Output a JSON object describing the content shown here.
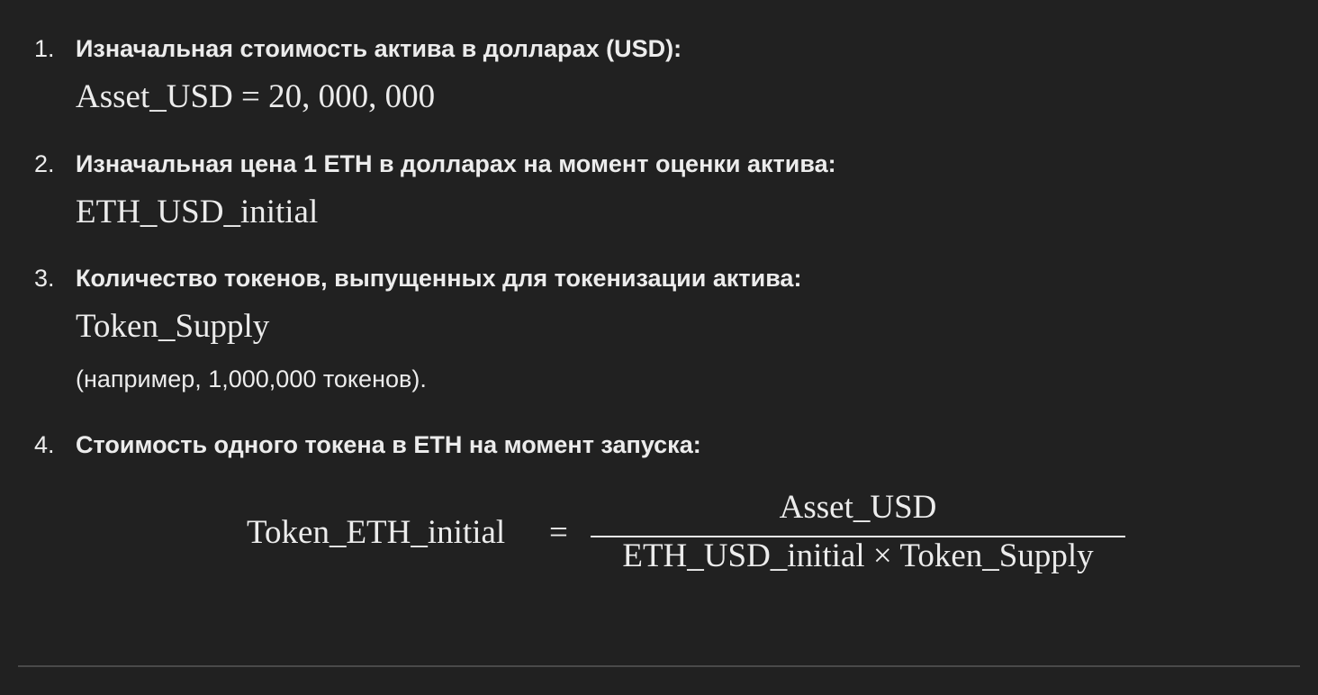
{
  "items": [
    {
      "number": "1.",
      "heading": "Изначальная стоимость актива в долларах (USD):",
      "math": "Asset_USD = 20, 000, 000"
    },
    {
      "number": "2.",
      "heading": "Изначальная цена 1 ETH в долларах на момент оценки актива:",
      "math": "ETH_USD_initial"
    },
    {
      "number": "3.",
      "heading": "Количество токенов, выпущенных для токенизации актива:",
      "math": "Token_Supply",
      "note": "(например, 1,000,000 токенов)."
    },
    {
      "number": "4.",
      "heading": "Стоимость одного токена в ETH на момент запуска:"
    }
  ],
  "formula": {
    "lhs": "Token_ETH_initial",
    "equals": "=",
    "numerator": "Asset_USD",
    "denominator": "ETH_USD_initial × Token_Supply"
  }
}
